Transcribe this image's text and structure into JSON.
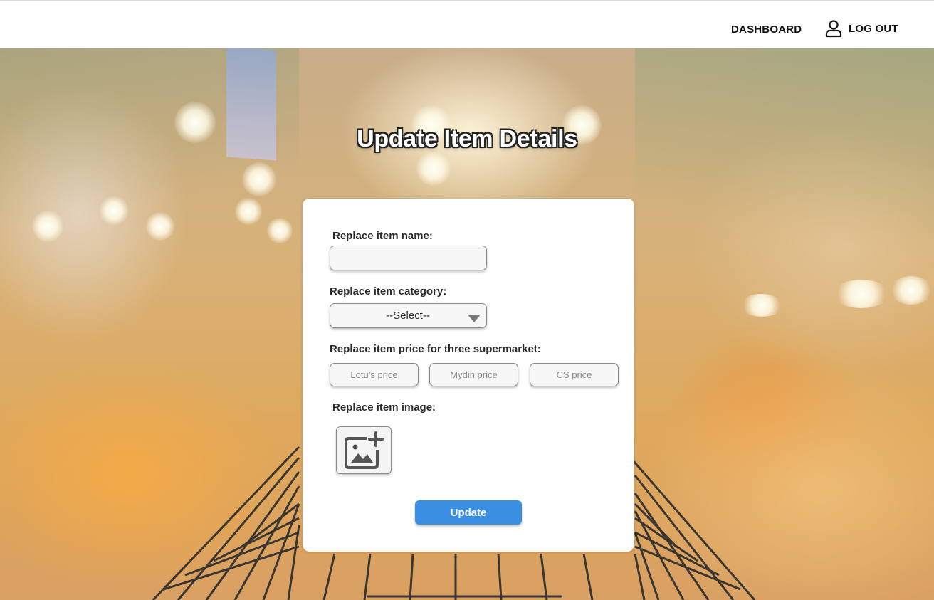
{
  "header": {
    "dashboard_label": "DASHBOARD",
    "logout_label": "LOG OUT"
  },
  "page": {
    "title": "Update Item Details"
  },
  "form": {
    "name_label": "Replace item name:",
    "name_value": "",
    "category_label": "Replace item category:",
    "category_selected": "--Select--",
    "price_label": "Replace item price for three supermarket:",
    "prices": [
      {
        "placeholder": "Lotu’s price",
        "value": ""
      },
      {
        "placeholder": "Mydin price",
        "value": ""
      },
      {
        "placeholder": "CS price",
        "value": ""
      }
    ],
    "image_label": "Replace item image:",
    "image_icon": "add-photo-icon",
    "submit_label": "Update"
  },
  "colors": {
    "accent": "#3b8fe3",
    "header_bg": "#ffffff",
    "card_bg": "#ffffff"
  }
}
